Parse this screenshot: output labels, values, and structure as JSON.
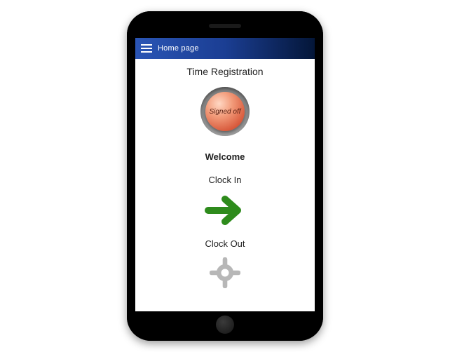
{
  "appbar": {
    "title": "Home page"
  },
  "page": {
    "title": "Time Registration",
    "status_label": "Signed off",
    "welcome": "Welcome",
    "clock_in_label": "Clock In",
    "clock_out_label": "Clock Out"
  },
  "colors": {
    "accent_bar_start": "#2a55b5",
    "accent_bar_end": "#041638",
    "clock_in_arrow": "#2e8b1c",
    "clock_out_icon": "#b7b7b7",
    "status_orb": "#e88060"
  }
}
